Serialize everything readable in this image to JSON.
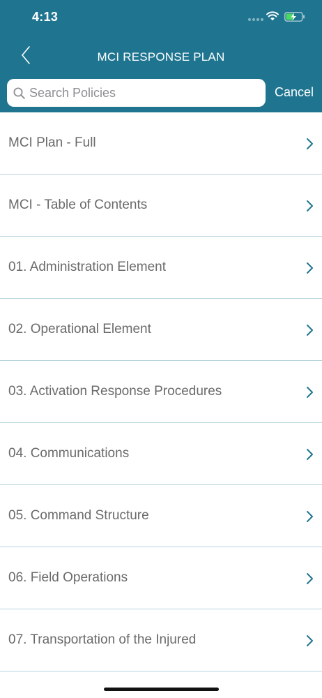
{
  "status_bar": {
    "time": "4:13"
  },
  "nav": {
    "title": "MCI RESPONSE PLAN",
    "back_icon": "chevron-left-icon"
  },
  "search": {
    "placeholder": "Search Policies",
    "value": "",
    "cancel_label": "Cancel"
  },
  "colors": {
    "header_bg": "#1f7590",
    "separator": "#b7d3de",
    "chevron": "#1f7590",
    "item_text": "#6a6a6a"
  },
  "list": {
    "items": [
      {
        "label": "MCI Plan - Full"
      },
      {
        "label": "MCI - Table of Contents"
      },
      {
        "label": "01. Administration Element"
      },
      {
        "label": "02. Operational Element"
      },
      {
        "label": "03. Activation Response Procedures"
      },
      {
        "label": "04. Communications"
      },
      {
        "label": "05. Command Structure"
      },
      {
        "label": "06. Field Operations"
      },
      {
        "label": "07. Transportation of the Injured"
      }
    ]
  }
}
